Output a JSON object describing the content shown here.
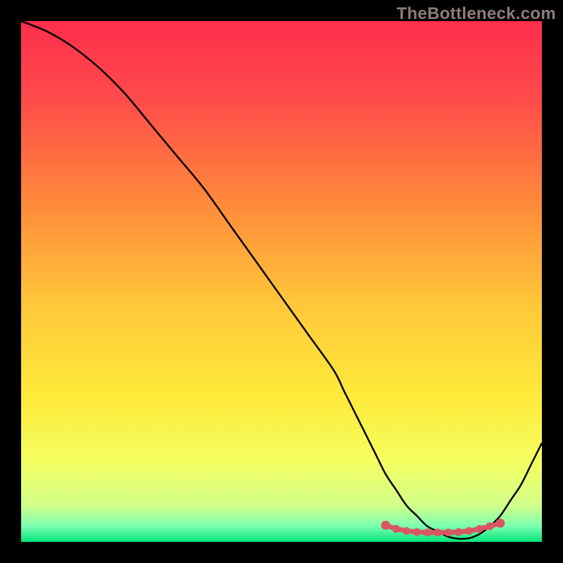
{
  "watermark": "TheBottleneck.com",
  "chart_data": {
    "type": "line",
    "title": "",
    "xlabel": "",
    "ylabel": "",
    "xlim": [
      0,
      100
    ],
    "ylim": [
      0,
      100
    ],
    "grid": false,
    "legend": false,
    "series": [
      {
        "name": "bottleneck-curve",
        "x": [
          0,
          5,
          10,
          15,
          20,
          25,
          30,
          35,
          40,
          45,
          50,
          55,
          60,
          62,
          64,
          66,
          68,
          70,
          72,
          74,
          76,
          78,
          80,
          82,
          84,
          86,
          88,
          90,
          92,
          94,
          96,
          98,
          100
        ],
        "y": [
          100,
          98,
          95,
          91,
          86,
          80,
          74,
          68,
          61,
          54,
          47,
          40,
          33,
          29,
          25,
          21,
          17,
          13,
          10,
          7,
          5,
          3,
          2,
          1,
          0.6,
          0.7,
          1.5,
          3,
          5,
          8,
          11,
          15,
          19
        ]
      },
      {
        "name": "optimal-markers",
        "x": [
          70,
          72,
          74,
          76,
          78,
          80,
          82,
          84,
          86,
          88,
          90,
          92
        ],
        "y": [
          3.2,
          2.5,
          2.1,
          1.9,
          1.8,
          1.8,
          1.8,
          1.9,
          2.1,
          2.5,
          3.0,
          3.6
        ]
      }
    ],
    "background_gradient": {
      "stops": [
        {
          "offset": 0.0,
          "color": "#ff2e4c"
        },
        {
          "offset": 0.15,
          "color": "#ff4b4b"
        },
        {
          "offset": 0.35,
          "color": "#ff8a3a"
        },
        {
          "offset": 0.55,
          "color": "#ffc93a"
        },
        {
          "offset": 0.72,
          "color": "#feea3a"
        },
        {
          "offset": 0.85,
          "color": "#f4ff62"
        },
        {
          "offset": 0.93,
          "color": "#d2ff8a"
        },
        {
          "offset": 0.97,
          "color": "#7cffb0"
        },
        {
          "offset": 1.0,
          "color": "#00e47a"
        }
      ]
    },
    "marker_color": "#d95763",
    "line_color": "#000000"
  }
}
